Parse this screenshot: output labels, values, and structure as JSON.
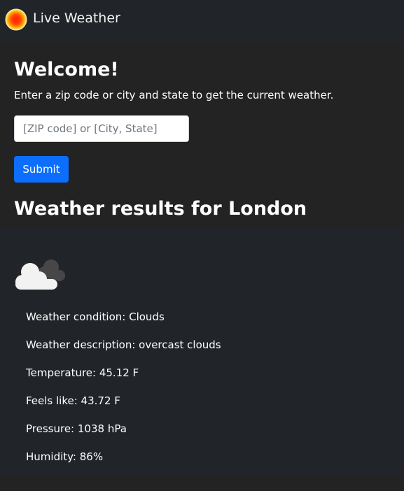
{
  "app": {
    "title": "Live Weather",
    "logo_icon": "sun-logo-icon"
  },
  "welcome": {
    "heading": "Welcome!",
    "instructions": "Enter a zip code or city and state to get the current weather."
  },
  "search": {
    "value": "",
    "placeholder": "[ZIP code] or [City, State]",
    "submit_label": "Submit"
  },
  "results": {
    "heading": "Weather results for London",
    "icon": "cloud-icon",
    "details": {
      "condition": "Weather condition: Clouds",
      "description": "Weather description: overcast clouds",
      "temperature": "Temperature: 45.12 F",
      "feels_like": "Feels like: 43.72 F",
      "pressure": "Pressure: 1038 hPa",
      "humidity": "Humidity: 86%"
    }
  },
  "colors": {
    "navbar_bg": "#212529",
    "page_bg": "#232323",
    "primary_button": "#0d6efd",
    "results_bg": "#212529"
  }
}
